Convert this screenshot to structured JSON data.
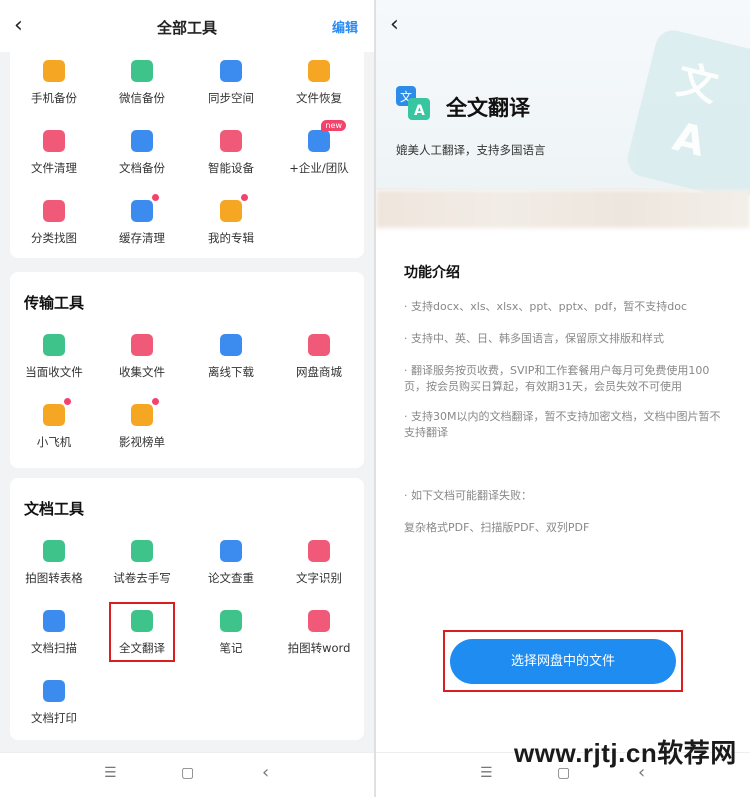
{
  "left": {
    "title": "全部工具",
    "edit_label": "编辑",
    "group1": [
      {
        "label": "手机备份",
        "icon": "phone-backup-icon",
        "color": "#f5a623"
      },
      {
        "label": "微信备份",
        "icon": "wechat-backup-icon",
        "color": "#3ec48a"
      },
      {
        "label": "同步空间",
        "icon": "sync-space-icon",
        "color": "#3c8cf0"
      },
      {
        "label": "文件恢复",
        "icon": "file-recover-icon",
        "color": "#f5a623"
      },
      {
        "label": "文件清理",
        "icon": "file-clean-icon",
        "color": "#f05a78"
      },
      {
        "label": "文档备份",
        "icon": "doc-backup-icon",
        "color": "#3c8cf0"
      },
      {
        "label": "智能设备",
        "icon": "smart-device-icon",
        "color": "#f05a78"
      },
      {
        "label": "+企业/团队",
        "icon": "enterprise-icon",
        "color": "#3c8cf0",
        "badge": "new"
      },
      {
        "label": "分类找图",
        "icon": "image-search-icon",
        "color": "#f05a78"
      },
      {
        "label": "缓存清理",
        "icon": "cache-clean-icon",
        "color": "#3c8cf0"
      },
      {
        "label": "我的专辑",
        "icon": "album-icon",
        "color": "#f5a623"
      }
    ],
    "transfer": {
      "title": "传输工具",
      "items": [
        {
          "label": "当面收文件",
          "icon": "face-receive-icon",
          "color": "#3ec48a"
        },
        {
          "label": "收集文件",
          "icon": "collect-files-icon",
          "color": "#f05a78"
        },
        {
          "label": "离线下载",
          "icon": "offline-download-icon",
          "color": "#3c8cf0"
        },
        {
          "label": "网盘商城",
          "icon": "store-icon",
          "color": "#f05a78"
        },
        {
          "label": "小飞机",
          "icon": "paper-plane-icon",
          "color": "#f5a623"
        },
        {
          "label": "影视榜单",
          "icon": "movie-rank-icon",
          "color": "#f5a623"
        }
      ]
    },
    "docs": {
      "title": "文档工具",
      "items": [
        {
          "label": "拍图转表格",
          "icon": "photo-to-table-icon",
          "color": "#3ec48a"
        },
        {
          "label": "试卷去手写",
          "icon": "remove-handwriting-icon",
          "color": "#3ec48a"
        },
        {
          "label": "论文查重",
          "icon": "plagiarism-check-icon",
          "color": "#3c8cf0"
        },
        {
          "label": "文字识别",
          "icon": "ocr-icon",
          "color": "#f05a78"
        },
        {
          "label": "文档扫描",
          "icon": "doc-scan-icon",
          "color": "#3c8cf0"
        },
        {
          "label": "全文翻译",
          "icon": "translate-icon",
          "color": "#3ec48a"
        },
        {
          "label": "笔记",
          "icon": "note-icon",
          "color": "#3ec48a"
        },
        {
          "label": "拍图转word",
          "icon": "photo-to-word-icon",
          "color": "#f05a78"
        },
        {
          "label": "文档打印",
          "icon": "doc-print-icon",
          "color": "#3c8cf0"
        }
      ]
    }
  },
  "right": {
    "title": "全文翻译",
    "subtitle": "媲美人工翻译，支持多国语言",
    "intro_title": "功能介绍",
    "paragraphs": [
      "· 支持docx、xls、xlsx、ppt、pptx、pdf，暂不支持doc",
      "· 支持中、英、日、韩多国语言，保留原文排版和样式",
      "· 翻译服务按页收费，SVIP和工作套餐用户每月可免费使用100页，按会员购买日算起，有效期31天，会员失效不可使用",
      "· 支持30M以内的文档翻译，暂不支持加密文档，文档中图片暂不支持翻译",
      "· 如下文档可能翻译失败：",
      "复杂格式PDF、扫描版PDF、双列PDF"
    ],
    "cta_label": "选择网盘中的文件"
  },
  "watermark": "www.rjtj.cn软荐网",
  "colors": {
    "accent": "#1e8cf0",
    "highlight": "#d81e1e",
    "badge": "#f2446b"
  }
}
